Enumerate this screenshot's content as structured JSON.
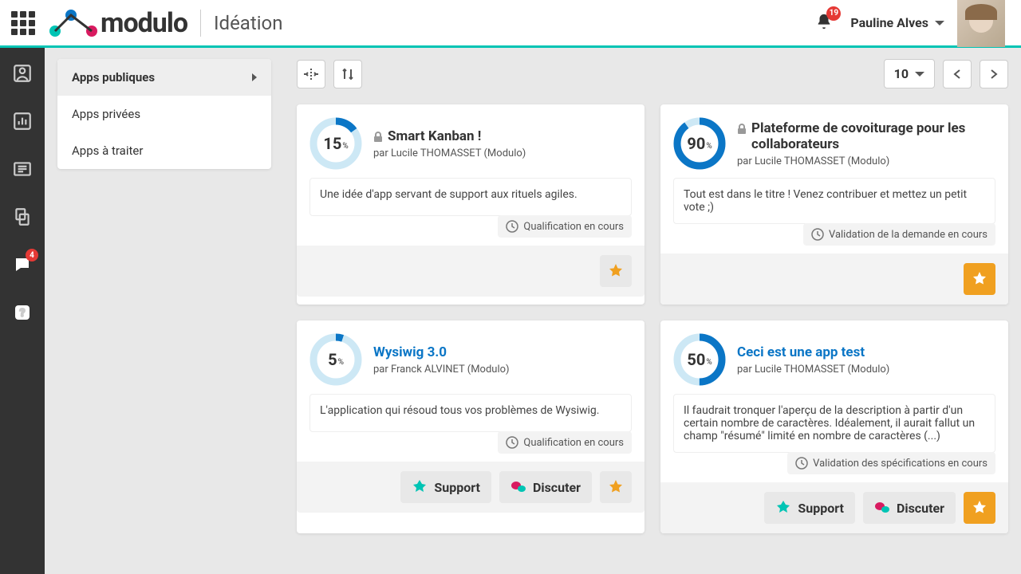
{
  "header": {
    "app_name": "modulo",
    "page": "Idéation",
    "notifications": 19,
    "user_name": "Pauline Alves"
  },
  "rail": {
    "chat_badge": 4
  },
  "sidebar": {
    "items": [
      {
        "label": "Apps publiques",
        "active": true
      },
      {
        "label": "Apps privées",
        "active": false
      },
      {
        "label": "Apps à traiter",
        "active": false
      }
    ]
  },
  "toolbar": {
    "page_size": "10"
  },
  "status": {
    "qualification": "Qualification en cours",
    "validation_demande": "Validation de la demande en cours",
    "validation_specs": "Validation des spécifications en cours"
  },
  "actions": {
    "support": "Support",
    "discuss": "Discuter"
  },
  "cards": [
    {
      "percent": 15,
      "locked": true,
      "title_link": false,
      "title": "Smart Kanban !",
      "author": "par Lucile THOMASSET (Modulo)",
      "desc": "Une idée d'app servant de support aux rituels agiles.",
      "status_key": "qualification",
      "show_actions": false,
      "star_active": false
    },
    {
      "percent": 90,
      "locked": true,
      "title_link": false,
      "title": "Plateforme de covoiturage pour les collaborateurs",
      "author": "par Lucile THOMASSET (Modulo)",
      "desc": "Tout est dans le titre ! Venez contribuer et mettez un petit vote ;)",
      "status_key": "validation_demande",
      "show_actions": false,
      "star_active": true
    },
    {
      "percent": 5,
      "locked": false,
      "title_link": true,
      "title": "Wysiwig 3.0",
      "author": "par Franck ALVINET (Modulo)",
      "desc": "L'application qui résoud tous vos problèmes de Wysiwig.",
      "status_key": "qualification",
      "show_actions": true,
      "star_active": false
    },
    {
      "percent": 50,
      "locked": false,
      "title_link": true,
      "title": "Ceci est une app test",
      "author": "par Lucile THOMASSET (Modulo)",
      "desc": "Il faudrait tronquer l'aperçu de la description à partir d'un certain nombre de caractères. Idéalement, il aurait fallut un champ \"résumé\" limité en nombre de caractères (...)",
      "status_key": "validation_specs",
      "show_actions": true,
      "star_active": true
    }
  ]
}
